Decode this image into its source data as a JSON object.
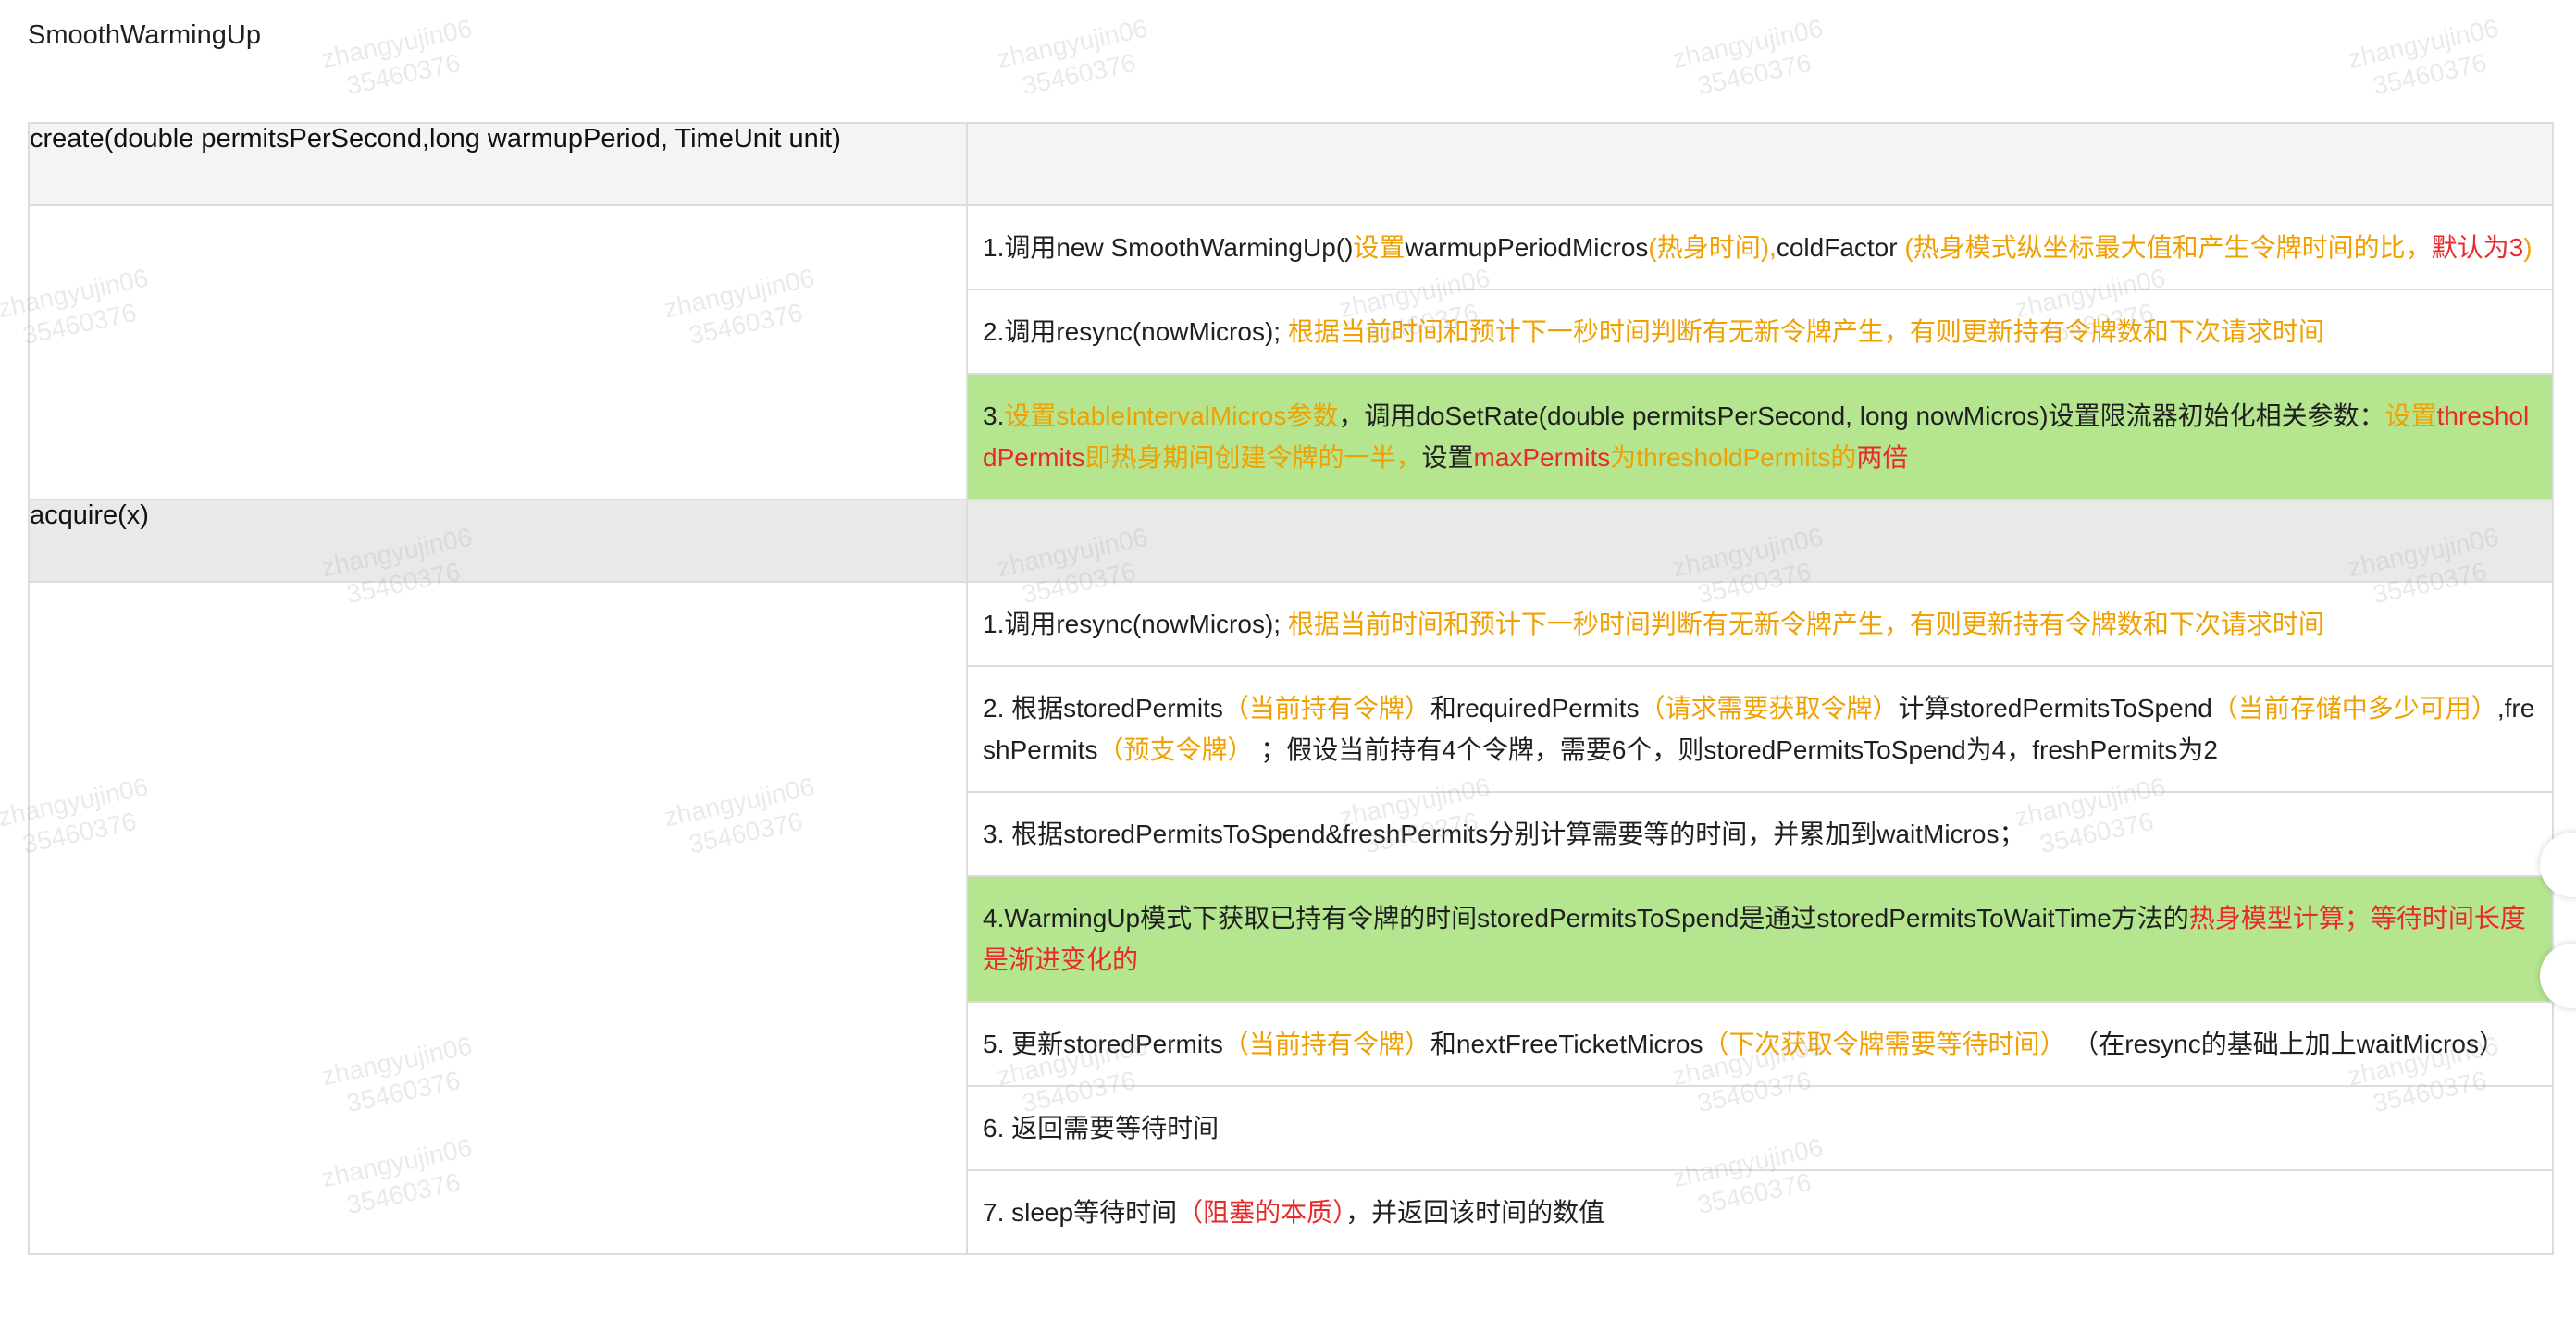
{
  "title": "SmoothWarmingUp",
  "watermark": "zhangyujin06\n35460376",
  "sections": [
    {
      "header": "create(double permitsPerSecond,long warmupPeriod, TimeUnit unit)",
      "steps": [
        {
          "wrap": true,
          "green": false,
          "segments": [
            {
              "c": "bk",
              "t": "1.调用new SmoothWarmingUp()"
            },
            {
              "c": "or",
              "t": "设置"
            },
            {
              "c": "bk",
              "t": "warmupPeriodMicros"
            },
            {
              "c": "or",
              "t": "(热身时间),"
            },
            {
              "c": "bk",
              "t": "coldFactor "
            },
            {
              "c": "or",
              "t": "(热身模式纵坐标最大值和产生令牌时间的比，"
            },
            {
              "c": "rd",
              "t": "默认为3"
            },
            {
              "c": "or",
              "t": ")"
            }
          ]
        },
        {
          "wrap": false,
          "green": false,
          "segments": [
            {
              "c": "bk",
              "t": "2.调用resync(nowMicros); "
            },
            {
              "c": "or",
              "t": "根据当前时间和预计下一秒时间判断有无新令牌产生，有则更新持有令牌数和下次请求时间"
            }
          ]
        },
        {
          "wrap": true,
          "green": true,
          "segments": [
            {
              "c": "bk",
              "t": "3."
            },
            {
              "c": "or",
              "t": "设置stableIntervalMicros参数"
            },
            {
              "c": "bk",
              "t": "，调用doSetRate(double permitsPerSecond, long nowMicros)设置限流器初始化相关参数："
            },
            {
              "c": "or",
              "t": "设置"
            },
            {
              "c": "rd",
              "t": "thresholdPermits"
            },
            {
              "c": "or",
              "t": "即热身期间创建令牌的一半，"
            },
            {
              "c": "bk",
              "t": "设置"
            },
            {
              "c": "rd",
              "t": "maxPermits"
            },
            {
              "c": "or",
              "t": "为thresholdPermits的"
            },
            {
              "c": "rd",
              "t": "两倍"
            }
          ]
        }
      ]
    },
    {
      "header": "acquire(x)",
      "steps": [
        {
          "wrap": false,
          "green": false,
          "segments": [
            {
              "c": "bk",
              "t": "1.调用resync(nowMicros); "
            },
            {
              "c": "or",
              "t": "根据当前时间和预计下一秒时间判断有无新令牌产生，有则更新持有令牌数和下次请求时间"
            }
          ]
        },
        {
          "wrap": true,
          "green": false,
          "segments": [
            {
              "c": "bk",
              "t": "2. 根据storedPermits"
            },
            {
              "c": "or",
              "t": "（当前持有令牌）"
            },
            {
              "c": "bk",
              "t": "和requiredPermits"
            },
            {
              "c": "or",
              "t": "（请求需要获取令牌）"
            },
            {
              "c": "bk",
              "t": "计算storedPermitsToSpend"
            },
            {
              "c": "or",
              "t": "（当前存储中多少可用）"
            },
            {
              "c": "bk",
              "t": ",freshPermits"
            },
            {
              "c": "or",
              "t": "（预支令牌）"
            },
            {
              "c": "bk",
              "t": " ；假设当前持有4个令牌，需要6个，则storedPermitsToSpend为4，freshPermits为2"
            }
          ]
        },
        {
          "wrap": false,
          "green": false,
          "segments": [
            {
              "c": "bk",
              "t": "3. 根据storedPermitsToSpend&freshPermits分别计算需要等的时间，并累加到waitMicros；"
            }
          ]
        },
        {
          "wrap": true,
          "green": true,
          "segments": [
            {
              "c": "bk",
              "t": "4.WarmingUp模式下获取已持有令牌的时间storedPermitsToSpend是通过storedPermitsToWaitTime方法的"
            },
            {
              "c": "rd",
              "t": "热身模型计算；等待时间长度是渐进变化的"
            }
          ]
        },
        {
          "wrap": false,
          "green": false,
          "segments": [
            {
              "c": "bk",
              "t": "5. 更新storedPermits"
            },
            {
              "c": "or",
              "t": "（当前持有令牌）"
            },
            {
              "c": "bk",
              "t": "和nextFreeTicketMicros"
            },
            {
              "c": "or",
              "t": "（下次获取令牌需要等待时间）"
            },
            {
              "c": "bk",
              "t": " （在resync的基础上加上waitMicros）"
            }
          ]
        },
        {
          "wrap": false,
          "green": false,
          "segments": [
            {
              "c": "bk",
              "t": "6. 返回需要等待时间"
            }
          ]
        },
        {
          "wrap": false,
          "green": false,
          "segments": [
            {
              "c": "bk",
              "t": "7. sleep等待时间"
            },
            {
              "c": "rd",
              "t": "（阻塞的本质）"
            },
            {
              "c": "bk",
              "t": "，并返回该时间的数值"
            }
          ]
        }
      ]
    }
  ]
}
